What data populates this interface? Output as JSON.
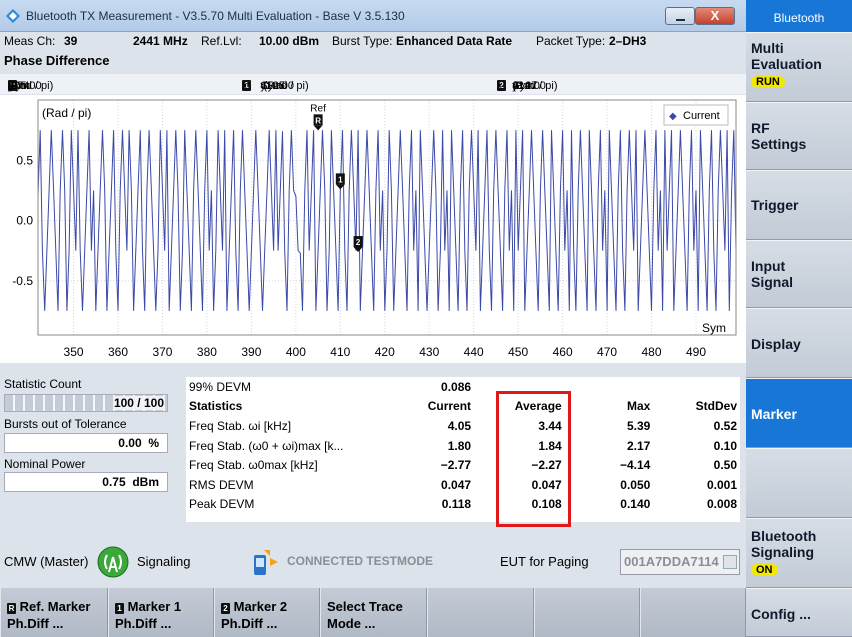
{
  "window": {
    "title": "Bluetooth TX Measurement  - V3.5.70 Multi Evaluation - Base V 3.5.130",
    "close": "X"
  },
  "info": {
    "meas_ch_label": "Meas Ch:",
    "meas_ch": "39",
    "freq": "2441 MHz",
    "ref_lvl_label": "Ref.Lvl:",
    "ref_lvl": "10.00 dBm",
    "burst_label": "Burst Type:",
    "burst": "Enhanced Data Rate",
    "packet_label": "Packet Type:",
    "packet": "2–DH3"
  },
  "section_title": "Phase Difference",
  "markers": {
    "ref": {
      "glyph": "R",
      "x_label": "x:",
      "x": "405.00",
      "unit": "Sym",
      "y_label": "y",
      "y": "0.74",
      "yunit": "(Rad / pi)"
    },
    "m1": {
      "glyph": "1",
      "x_label": "x:",
      "x": "410.00",
      "unit": "Sym",
      "y_label": "y:",
      "y": "0.25",
      "yunit": "(Rad / pi)"
    },
    "m2": {
      "glyph": "2",
      "x_label": "x:",
      "x": "414.00",
      "unit": "Sym",
      "y_label": "y:",
      "y": "-0.27",
      "yunit": "(Rad / pi)"
    }
  },
  "chart_data": {
    "type": "line",
    "ylabel": "(Rad / pi)",
    "xlabel": "Sym",
    "legend": "Current",
    "ref_label": "Ref",
    "xlim": [
      342,
      499
    ],
    "ylim": [
      -0.95,
      1.0
    ],
    "xticks": [
      350,
      360,
      370,
      380,
      390,
      400,
      410,
      420,
      430,
      440,
      450,
      460,
      470,
      480,
      490
    ],
    "xtick_labels": [
      "350",
      "360",
      "370",
      "380",
      "390",
      "400",
      "410",
      "420",
      "430",
      "440",
      "450",
      "460",
      "470",
      "480",
      "490"
    ],
    "yticks": [
      0.5,
      0.0,
      -0.5
    ],
    "ytick_labels": [
      "0.5",
      "0.0",
      "-0.5"
    ],
    "grid": true,
    "color": "#3b49a8",
    "series": [
      {
        "x_start": 342,
        "x_step": 0.5,
        "values": [
          0.2,
          0.75,
          -0.25,
          -0.75,
          -0.25,
          0.25,
          0.75,
          0.25,
          -0.25,
          -0.75,
          0.25,
          0.75,
          0.25,
          -0.75,
          -0.25,
          0.75,
          0.25,
          -0.25,
          0.75,
          -0.25,
          -0.75,
          -0.25,
          0.25,
          0.75,
          -0.25,
          0.25,
          -0.75,
          -0.25,
          0.25,
          0.75,
          0.25,
          -0.75,
          -0.25,
          0.25,
          0.75,
          -0.25,
          -0.75,
          0.25,
          0.75,
          0.25,
          -0.25,
          0.75,
          0.25,
          -0.75,
          -0.25,
          0.25,
          0.75,
          -0.25,
          -0.75,
          0.25,
          0.75,
          0.25,
          -0.25,
          -0.75,
          -0.25,
          0.75,
          0.25,
          -0.25,
          0.75,
          -0.75,
          -0.25,
          0.25,
          0.75,
          0.25,
          -0.75,
          -0.25,
          0.75,
          0.25,
          -0.25,
          -0.75,
          0.25,
          0.75,
          0.25,
          -0.25,
          -0.75,
          0.25,
          0.75,
          -0.25,
          0.25,
          -0.75,
          -0.25,
          0.75,
          0.25,
          -0.25,
          0.75,
          -0.75,
          -0.25,
          0.25,
          0.75,
          -0.25,
          -0.75,
          0.25,
          0.75,
          0.25,
          -0.25,
          -0.75,
          -0.25,
          0.25,
          0.75,
          0.25,
          -0.25,
          -0.75,
          -0.25,
          0.25,
          0.75,
          0.25,
          -0.25,
          0.75,
          -0.25,
          0.25,
          0.74,
          -0.25,
          -0.75,
          0.25,
          0.75,
          0.25,
          0.2,
          -0.25,
          -0.27,
          -0.75,
          0.25,
          0.75,
          -0.25,
          0.25,
          0.75,
          -0.75,
          -0.25,
          0.25,
          0.75,
          0.25,
          -0.75,
          -0.25,
          0.75,
          0.25,
          -0.25,
          -0.75,
          0.25,
          0.75,
          -0.25,
          -0.75,
          0.25,
          0.75,
          0.25,
          -0.25,
          0.75,
          -0.75,
          -0.25,
          0.25,
          0.75,
          0.25,
          -0.25,
          -0.75,
          0.25,
          0.75,
          -0.25,
          0.25,
          -0.75,
          -0.25,
          0.75,
          0.25,
          -0.75,
          -0.25,
          0.25,
          0.75,
          0.25,
          -0.25,
          -0.75,
          0.25,
          0.75,
          -0.25,
          0.25,
          -0.75,
          0.75,
          0.25,
          -0.25,
          -0.75,
          -0.25,
          0.25,
          0.75,
          0.25,
          -0.75,
          -0.25,
          0.75,
          -0.25,
          0.25,
          -0.75,
          0.75,
          0.25,
          -0.25,
          -0.75,
          0.25,
          0.75,
          -0.25,
          -0.75,
          0.25,
          0.75,
          0.25,
          -0.25,
          0.75,
          -0.75,
          -0.25,
          0.25,
          0.75,
          -0.25,
          -0.75,
          0.25,
          0.75,
          0.25,
          -0.25,
          -0.75,
          0.25,
          0.75,
          -0.25,
          0.25,
          -0.75,
          0.75,
          -0.25,
          0.25,
          0.75,
          -0.75,
          -0.25,
          0.25,
          0.75,
          0.25,
          -0.25,
          -0.75,
          0.25,
          0.75,
          0.25,
          -0.25,
          -0.75,
          0.75,
          0.25,
          -0.25,
          -0.75,
          0.25,
          0.75,
          -0.25,
          0.25,
          -0.75,
          0.75,
          -0.25,
          -0.75,
          0.25,
          0.75,
          0.25,
          -0.25,
          -0.75,
          0.75,
          0.25,
          -0.25,
          -0.75,
          0.25,
          0.75,
          -0.25,
          0.25,
          -0.75,
          0.75,
          0.25,
          -0.25,
          -0.75,
          0.25,
          0.75,
          -0.25,
          -0.75,
          0.25,
          0.75,
          0.25,
          -0.25,
          0.75,
          -0.75,
          -0.25,
          0.25,
          0.75,
          0.25,
          -0.25,
          -0.75,
          0.25,
          0.75,
          -0.25,
          0.25,
          -0.75,
          0.75,
          -0.25,
          0.25,
          0.75,
          -0.75,
          -0.25,
          0.25,
          0.75,
          0.25,
          -0.25,
          -0.75,
          0.25,
          0.75,
          -0.25,
          0.25,
          -0.75,
          0.75,
          0.25,
          -0.25,
          -0.75,
          0.25,
          0.75,
          -0.25,
          -0.75,
          0.25,
          0.75,
          0.25,
          -0.25,
          0.75,
          -0.75,
          0.25,
          0.75,
          -0.25,
          0.25,
          -0.75,
          0.75,
          0.25,
          -0.25,
          -0.75,
          0.25,
          0.75,
          -0.25,
          0.25,
          -0.75,
          0.75
        ]
      }
    ],
    "marker_points": [
      {
        "name": "R",
        "x": 405,
        "y": 0.74
      },
      {
        "name": "1",
        "x": 410,
        "y": 0.25
      },
      {
        "name": "2",
        "x": 414,
        "y": -0.27
      }
    ]
  },
  "left": {
    "stat_count_label": "Statistic Count",
    "stat_count": "100 / 100",
    "stat_progress": 1.0,
    "bursts_label": "Bursts out of Tolerance",
    "bursts_value": "0.00",
    "bursts_unit": "%",
    "power_label": "Nominal Power",
    "power_value": "0.75",
    "power_unit": "dBm"
  },
  "stats": {
    "devm_label": "99% DEVM",
    "devm_value": "0.086",
    "headers": [
      "Statistics",
      "Current",
      "Average",
      "Max",
      "StdDev"
    ],
    "rows": [
      [
        "Freq Stab. ωi [kHz]",
        "4.05",
        "3.44",
        "5.39",
        "0.52"
      ],
      [
        "Freq Stab. (ω0 + ωi)max [k...",
        "1.80",
        "1.84",
        "2.17",
        "0.10"
      ],
      [
        "Freq Stab. ω0max [kHz]",
        "−2.77",
        "−2.27",
        "−4.14",
        "0.50"
      ],
      [
        "RMS DEVM",
        "0.047",
        "0.047",
        "0.050",
        "0.001"
      ],
      [
        "Peak DEVM",
        "0.118",
        "0.108",
        "0.140",
        "0.008"
      ]
    ]
  },
  "status": {
    "cmw": "CMW (Master)",
    "signaling": "Signaling",
    "testmode": "CONNECTED TESTMODE",
    "eut_label": "EUT for Paging",
    "eut_value": "001A7DDA7114"
  },
  "softkeys": {
    "k1_l1": "Ref. Marker",
    "k1_l2": "Ph.Diff ...",
    "k2_l1": "Marker 1",
    "k2_l2": "Ph.Diff ...",
    "k3_l1": "Marker 2",
    "k3_l2": "Ph.Diff ...",
    "k4_l1": "Select Trace",
    "k4_l2": "Mode ..."
  },
  "side": {
    "header": "Bluetooth",
    "multi": "Multi Evaluation",
    "multi_badge": "RUN",
    "rf": "RF Settings",
    "trigger": "Trigger",
    "input": "Input Signal",
    "display": "Display",
    "marker": "Marker",
    "bt_sig": "Bluetooth Signaling",
    "bt_sig_badge": "ON",
    "config": "Config ..."
  },
  "colors": {
    "accent": "#1877d6",
    "trace": "#3b49a8",
    "highlight": "#e01818",
    "badge": "#f1e800"
  }
}
